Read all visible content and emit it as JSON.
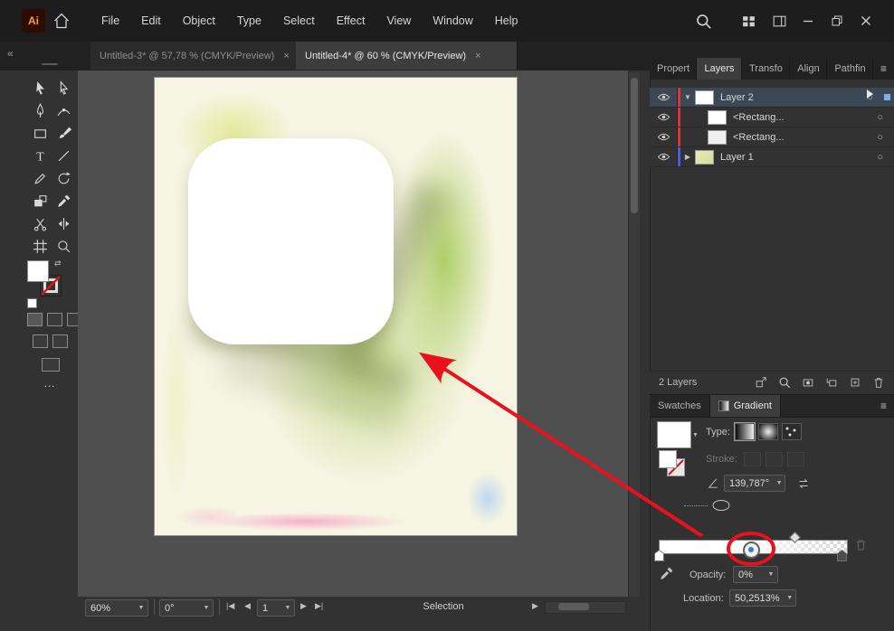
{
  "titlebar": {
    "logo": "Ai",
    "menus": [
      "File",
      "Edit",
      "Object",
      "Type",
      "Select",
      "Effect",
      "View",
      "Window",
      "Help"
    ]
  },
  "icons": {
    "collapse_left": "«",
    "menu": "≡",
    "target": "○",
    "chevron_down": "▼",
    "chevron_right": "▶",
    "close": "×",
    "more": "…",
    "nav_first": "|◀",
    "nav_prev": "◀",
    "nav_next": "▶",
    "nav_last": "▶|"
  },
  "document_tabs": [
    {
      "label": "Untitled-3* @ 57,78 % (CMYK/Preview)"
    },
    {
      "label": "Untitled-4* @ 60 % (CMYK/Preview)"
    }
  ],
  "toolbar": {
    "tools": [
      "selection",
      "direct-selection",
      "pen",
      "curvature",
      "rectangle",
      "paintbrush",
      "type",
      "line-segment",
      "pencil",
      "rotate",
      "shape-builder",
      "eyedropper",
      "scissors",
      "width",
      "artboard",
      "zoom"
    ]
  },
  "statusbar": {
    "zoom": "60%",
    "rotation": "0°",
    "artboard_number": "1",
    "status": "Selection"
  },
  "panels": {
    "tabs": [
      "Propert",
      "Layers",
      "Transfo",
      "Align",
      "Pathfin"
    ],
    "layers": {
      "rows": [
        {
          "name": "Layer 2"
        },
        {
          "name": "<Rectang..."
        },
        {
          "name": "<Rectang..."
        },
        {
          "name": "Layer 1"
        }
      ],
      "footer": "2 Layers"
    },
    "gradient": {
      "tabs": [
        "Swatches",
        "Gradient"
      ],
      "type_label": "Type:",
      "stroke_label": "Stroke:",
      "angle_value": "139,787°",
      "opacity_label": "Opacity:",
      "opacity_value": "0%",
      "location_label": "Location:",
      "location_value": "50,2513%"
    }
  },
  "colors": {
    "annotation_red": "#e8111c",
    "selection_blue": "#2f7fd4",
    "layer_color_red": "#d9363e",
    "layer_color_blue": "#4a62d8"
  }
}
